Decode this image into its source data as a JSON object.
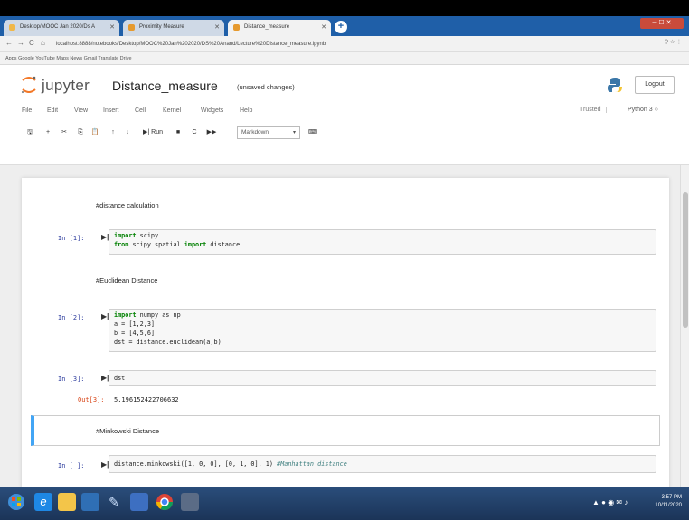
{
  "browser": {
    "tabs": [
      {
        "label": "Desktop/MOOC Jan 2020/Ds A"
      },
      {
        "label": "Proximity Measure"
      },
      {
        "label": "Distance_measure"
      }
    ],
    "url": "localhost:8888/notebooks/Desktop/MOOC%20Jan%202020/DS%20Anand/Lecture%20Distance_measure.ipynb",
    "bookmarks": "Apps   Google   YouTube   Maps   News   Gmail   Translate   Drive",
    "colors": {
      "tabstrip": "#1f5fa8",
      "taskbar": "#1b3458"
    }
  },
  "jupyter": {
    "brand": "jupyter",
    "title": "Distance_measure",
    "status": "(unsaved changes)",
    "logout": "Logout",
    "menu": [
      "File",
      "Edit",
      "View",
      "Insert",
      "Cell",
      "Kernel",
      "Widgets",
      "Help"
    ],
    "trusted": "Trusted",
    "kernel": "Python 3",
    "toolbar": {
      "run": "Run",
      "cell_type": "Markdown"
    }
  },
  "cells": {
    "md1": "#distance calculation",
    "c1": {
      "prompt": "In [1]:",
      "line1_kw": "import",
      "line1_rest": " scipy",
      "line2_kw1": "from",
      "line2_mid": " scipy.spatial ",
      "line2_kw2": "import",
      "line2_rest": " distance"
    },
    "md2": "#Euclidean Distance",
    "c2": {
      "prompt": "In [2]:",
      "line1_kw": "import",
      "line1_rest": " numpy as np",
      "line2": "a = [1,2,3]",
      "line3": "b = [4,5,6]",
      "line4": "dst = distance.euclidean(a,b)"
    },
    "c3": {
      "prompt": "In [3]:",
      "code": "dst",
      "out_prompt": "Out[3]:",
      "output": "5.196152422706632"
    },
    "md3": "#Minkowski Distance",
    "c4": {
      "prompt": "In [ ]:",
      "code": "distance.minkowski([1, 0, 0], [0, 1, 0], 1)",
      "comment": " #Manhattan distance"
    }
  },
  "taskbar": {
    "time": "3:57 PM",
    "date": "10/11/2020"
  }
}
